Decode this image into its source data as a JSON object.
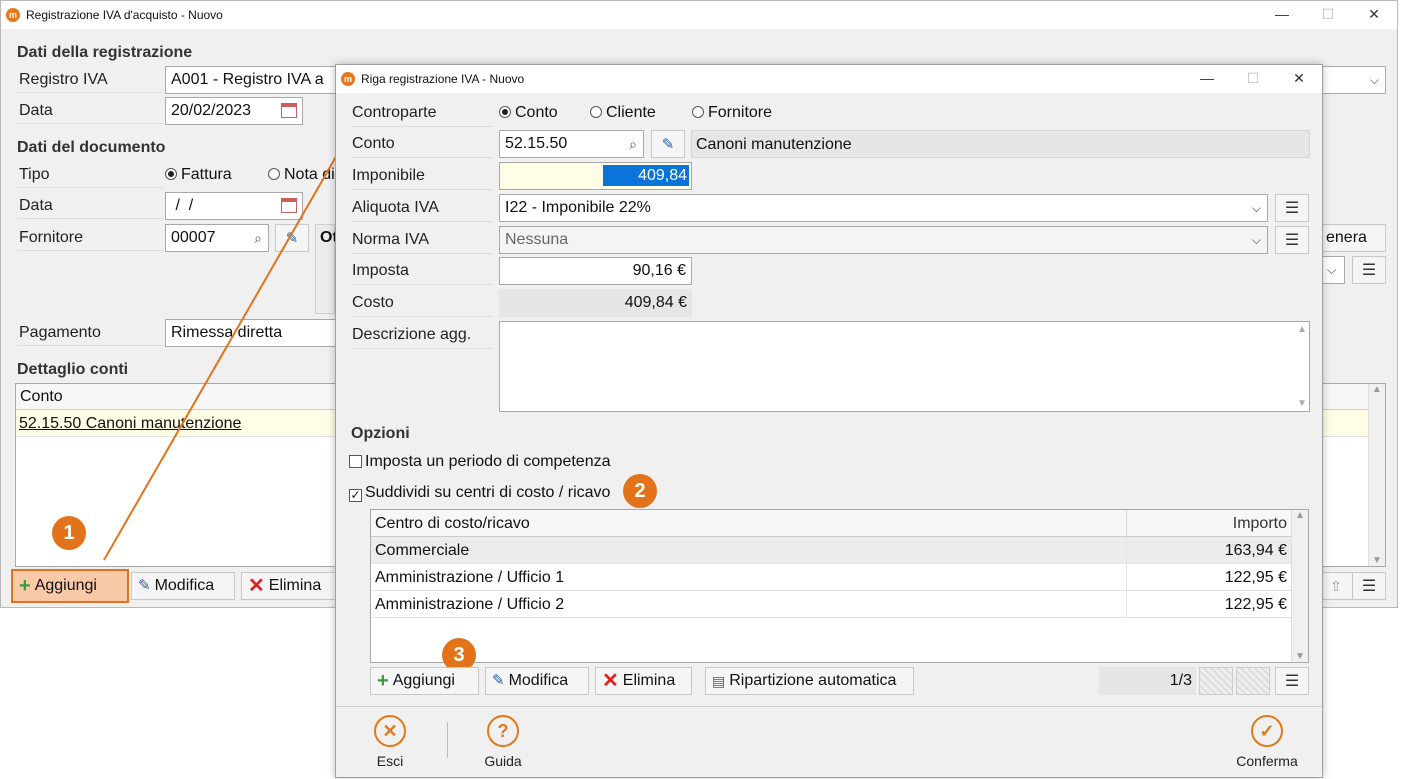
{
  "main": {
    "title": "Registrazione IVA d'acquisto - Nuovo",
    "sec_registrazione": "Dati della registrazione",
    "registro_label": "Registro IVA",
    "registro_value": "A001 - Registro IVA a",
    "data_label": "Data",
    "data_value": "20/02/2023",
    "sec_documento": "Dati del documento",
    "tipo_label": "Tipo",
    "tipo_opt1": "Fattura",
    "tipo_opt2": "Nota di",
    "docdata_label": "Data",
    "docdata_value": " /  /",
    "fornitore_label": "Fornitore",
    "fornitore_value": "00007",
    "fornitore_name": "Ot",
    "genera_label": "enera",
    "pagamento_label": "Pagamento",
    "pagamento_value": "Rimessa diretta",
    "sec_dettaglio": "Dettaglio conti",
    "col_conto": "Conto",
    "row1": "52.15.50 Canoni manutenzione",
    "btn_aggiungi": "Aggiungi",
    "btn_modifica": "Modifica",
    "btn_elimina": "Elimina"
  },
  "dialog": {
    "title": "Riga registrazione IVA - Nuovo",
    "controparte_label": "Controparte",
    "opt_conto": "Conto",
    "opt_cliente": "Cliente",
    "opt_fornitore": "Fornitore",
    "conto_label": "Conto",
    "conto_value": "52.15.50",
    "conto_desc": "Canoni manutenzione",
    "imponibile_label": "Imponibile",
    "imponibile_value": "409,84",
    "aliquota_label": "Aliquota IVA",
    "aliquota_value": "I22 - Imponibile 22%",
    "norma_label": "Norma IVA",
    "norma_value": "Nessuna",
    "imposta_label": "Imposta",
    "imposta_value": "90,16 €",
    "costo_label": "Costo",
    "costo_value": "409,84 €",
    "descr_label": "Descrizione agg.",
    "opzioni_title": "Opzioni",
    "chk_periodo": "Imposta un periodo di competenza",
    "chk_centri": "Suddividi su centri di costo / ricavo",
    "grid_col1": "Centro di costo/ricavo",
    "grid_col2": "Importo",
    "rows": [
      {
        "name": "Commerciale",
        "amount": "163,94 €"
      },
      {
        "name": "Amministrazione / Ufficio 1",
        "amount": "122,95 €"
      },
      {
        "name": "Amministrazione / Ufficio 2",
        "amount": "122,95 €"
      }
    ],
    "btn_aggiungi": "Aggiungi",
    "btn_modifica": "Modifica",
    "btn_elimina": "Elimina",
    "btn_ripartizione": "Ripartizione automatica",
    "pager": "1/3",
    "foot_esci": "Esci",
    "foot_guida": "Guida",
    "foot_conferma": "Conferma"
  },
  "badges": {
    "b1": "1",
    "b2": "2",
    "b3": "3"
  },
  "colors": {
    "accent": "#e2731a",
    "selection": "#0a74d8",
    "highlight_row": "#fffde6"
  }
}
